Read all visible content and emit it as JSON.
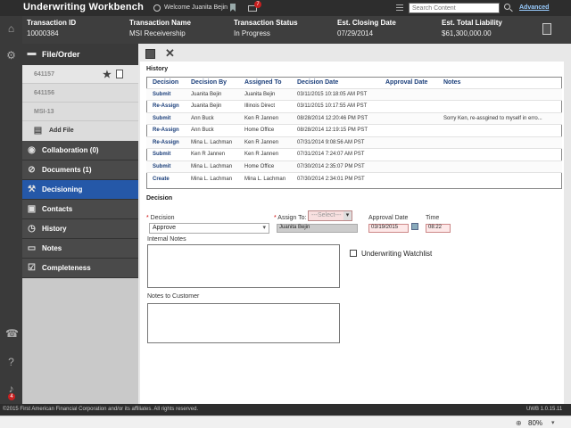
{
  "app": {
    "title": "Underwriting Workbench",
    "welcome": "Welcome Juanita Bejin",
    "mail_count": "7",
    "search_placeholder": "Search Content",
    "advanced_label": "Advanced"
  },
  "rail": {
    "notification_count": "4"
  },
  "transaction": {
    "columns": [
      {
        "header": "Transaction ID",
        "value": "10000384"
      },
      {
        "header": "Transaction Name",
        "value": "MSI Receivership"
      },
      {
        "header": "Transaction Status",
        "value": "In Progress"
      },
      {
        "header": "Est. Closing Date",
        "value": "07/29/2014"
      },
      {
        "header": "Est. Total Liability",
        "value": "$61,300,000.00"
      }
    ]
  },
  "sidebar": {
    "file_order_label": "File/Order",
    "orders": [
      "641157",
      "641156",
      "MSI-13"
    ],
    "add_file_label": "Add File",
    "items": [
      {
        "label": "Collaboration (0)",
        "icon": "collaboration-icon"
      },
      {
        "label": "Documents (1)",
        "icon": "paperclip-icon"
      },
      {
        "label": "Decisioning",
        "icon": "gavel-icon"
      },
      {
        "label": "Contacts",
        "icon": "contacts-icon"
      },
      {
        "label": "History",
        "icon": "history-icon"
      },
      {
        "label": "Notes",
        "icon": "notes-icon"
      },
      {
        "label": "Completeness",
        "icon": "checklist-icon"
      }
    ]
  },
  "history": {
    "title": "History",
    "headers": [
      "Decision",
      "Decision By",
      "Assigned To",
      "Decision Date",
      "Approval Date",
      "Notes"
    ],
    "rows": [
      [
        "Submit",
        "Juanita Bejin",
        "Juanita Bejin",
        "03/11/2015 10:18:05 AM PST",
        "",
        ""
      ],
      [
        "Re-Assign",
        "Juanita Bejin",
        "Illinois Direct",
        "03/11/2015 10:17:55 AM PST",
        "",
        ""
      ],
      [
        "Submit",
        "Ann Buck",
        "Ken R Jannen",
        "08/28/2014 12:20:46 PM PST",
        "",
        "Sorry Ken, re-assgined to myself in erro..."
      ],
      [
        "Re-Assign",
        "Ann Buck",
        "Home Office",
        "08/28/2014 12:19:15 PM PST",
        "",
        ""
      ],
      [
        "Re-Assign",
        "Mina L. Lachman",
        "Ken R Jannen",
        "07/31/2014 9:08:56 AM PST",
        "",
        ""
      ],
      [
        "Submit",
        "Ken R Jannen",
        "Ken R Jannen",
        "07/31/2014 7:24:07 AM PST",
        "",
        ""
      ],
      [
        "Submit",
        "Mina L. Lachman",
        "Home Office",
        "07/30/2014 2:35:07 PM PST",
        "",
        ""
      ],
      [
        "Create",
        "Mina L. Lachman",
        "Mina L. Lachman",
        "07/30/2014 2:34:01 PM PST",
        "",
        ""
      ]
    ]
  },
  "decision": {
    "title": "Decision",
    "decision_label": "Decision",
    "decision_value": "Approve",
    "assign_label": "Assign To:",
    "assign_select": "---Select---",
    "assign_value": "Juanita Bejin",
    "approval_date_label": "Approval Date",
    "approval_date_value": "03/19/2015",
    "time_label": "Time",
    "time_value": "08:22",
    "internal_notes_label": "Internal Notes",
    "watchlist_label": "Underwriting Watchlist",
    "customer_notes_label": "Notes to Customer"
  },
  "footer": {
    "copyright": "©2015 First American Financial Corporation and/or its affiliates. All rights reserved.",
    "version": "UWB 1.0.15.11"
  },
  "status": {
    "zoom": "80%"
  }
}
